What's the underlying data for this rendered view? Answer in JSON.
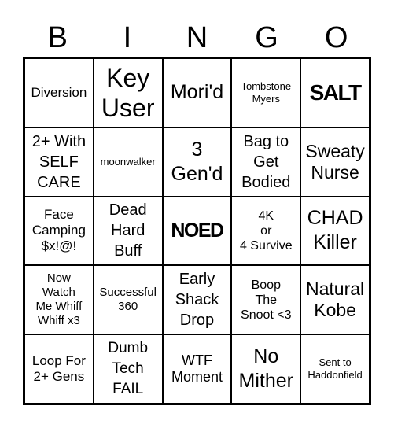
{
  "header": [
    "B",
    "I",
    "N",
    "G",
    "O"
  ],
  "cells": [
    {
      "text": "Diversion",
      "size": "s17",
      "bold": false
    },
    {
      "text": "Key\nUser",
      "size": "s30",
      "bold": false
    },
    {
      "text": "Mori'd",
      "size": "s24",
      "bold": false
    },
    {
      "text": "Tombstone\nMyers",
      "size": "s13",
      "bold": false
    },
    {
      "text": "SALT",
      "size": "s26",
      "bold": true
    },
    {
      "text": "2+ With\nSELF\nCARE",
      "size": "s20",
      "bold": false
    },
    {
      "text": "moonwalker",
      "size": "s13",
      "bold": false
    },
    {
      "text": "3\nGen'd",
      "size": "s24",
      "bold": false
    },
    {
      "text": "Bag to\nGet\nBodied",
      "size": "s20",
      "bold": false
    },
    {
      "text": "Sweaty\nNurse",
      "size": "s22",
      "bold": false
    },
    {
      "text": "Face\nCamping\n$x!@!",
      "size": "s17",
      "bold": false
    },
    {
      "text": "Dead\nHard\nBuff",
      "size": "s20",
      "bold": false
    },
    {
      "text": "NOED",
      "size": "s24",
      "bold": true
    },
    {
      "text": "4K\nor\n4 Survive",
      "size": "s16",
      "bold": false
    },
    {
      "text": "CHAD\nKiller",
      "size": "s24",
      "bold": false
    },
    {
      "text": "Now\nWatch\nMe Whiff\nWhiff x3",
      "size": "s15",
      "bold": false
    },
    {
      "text": "Successful\n360",
      "size": "s15",
      "bold": false
    },
    {
      "text": "Early\nShack\nDrop",
      "size": "s20",
      "bold": false
    },
    {
      "text": "Boop\nThe\nSnoot <3",
      "size": "s16",
      "bold": false
    },
    {
      "text": "Natural\nKobe",
      "size": "s22",
      "bold": false
    },
    {
      "text": "Loop For\n2+ Gens",
      "size": "s17",
      "bold": false
    },
    {
      "text": "Dumb\nTech\nFAIL",
      "size": "s19",
      "bold": false
    },
    {
      "text": "WTF\nMoment",
      "size": "s18",
      "bold": false
    },
    {
      "text": "No\nMither",
      "size": "s24",
      "bold": false
    },
    {
      "text": "Sent to\nHaddonfield",
      "size": "s13",
      "bold": false
    }
  ]
}
